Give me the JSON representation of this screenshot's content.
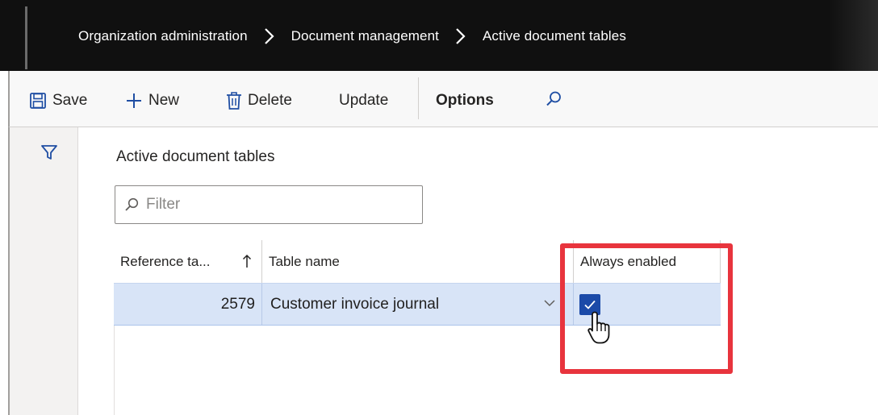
{
  "breadcrumb": [
    "Organization administration",
    "Document management",
    "Active document tables"
  ],
  "toolbar": {
    "save_label": "Save",
    "new_label": "New",
    "delete_label": "Delete",
    "update_label": "Update",
    "options_label": "Options"
  },
  "page": {
    "title": "Active document tables"
  },
  "filter": {
    "placeholder": "Filter"
  },
  "grid": {
    "columns": [
      "Reference ta...",
      "Table name",
      "Always enabled"
    ],
    "rows": [
      {
        "reference_table": "2579",
        "table_name": "Customer invoice journal",
        "always_enabled": true
      }
    ]
  },
  "colors": {
    "nav_background": "#101010",
    "selected_row": "#d8e4f7",
    "checkbox_checked": "#1b4aa8",
    "highlight_box": "#e8343d"
  }
}
